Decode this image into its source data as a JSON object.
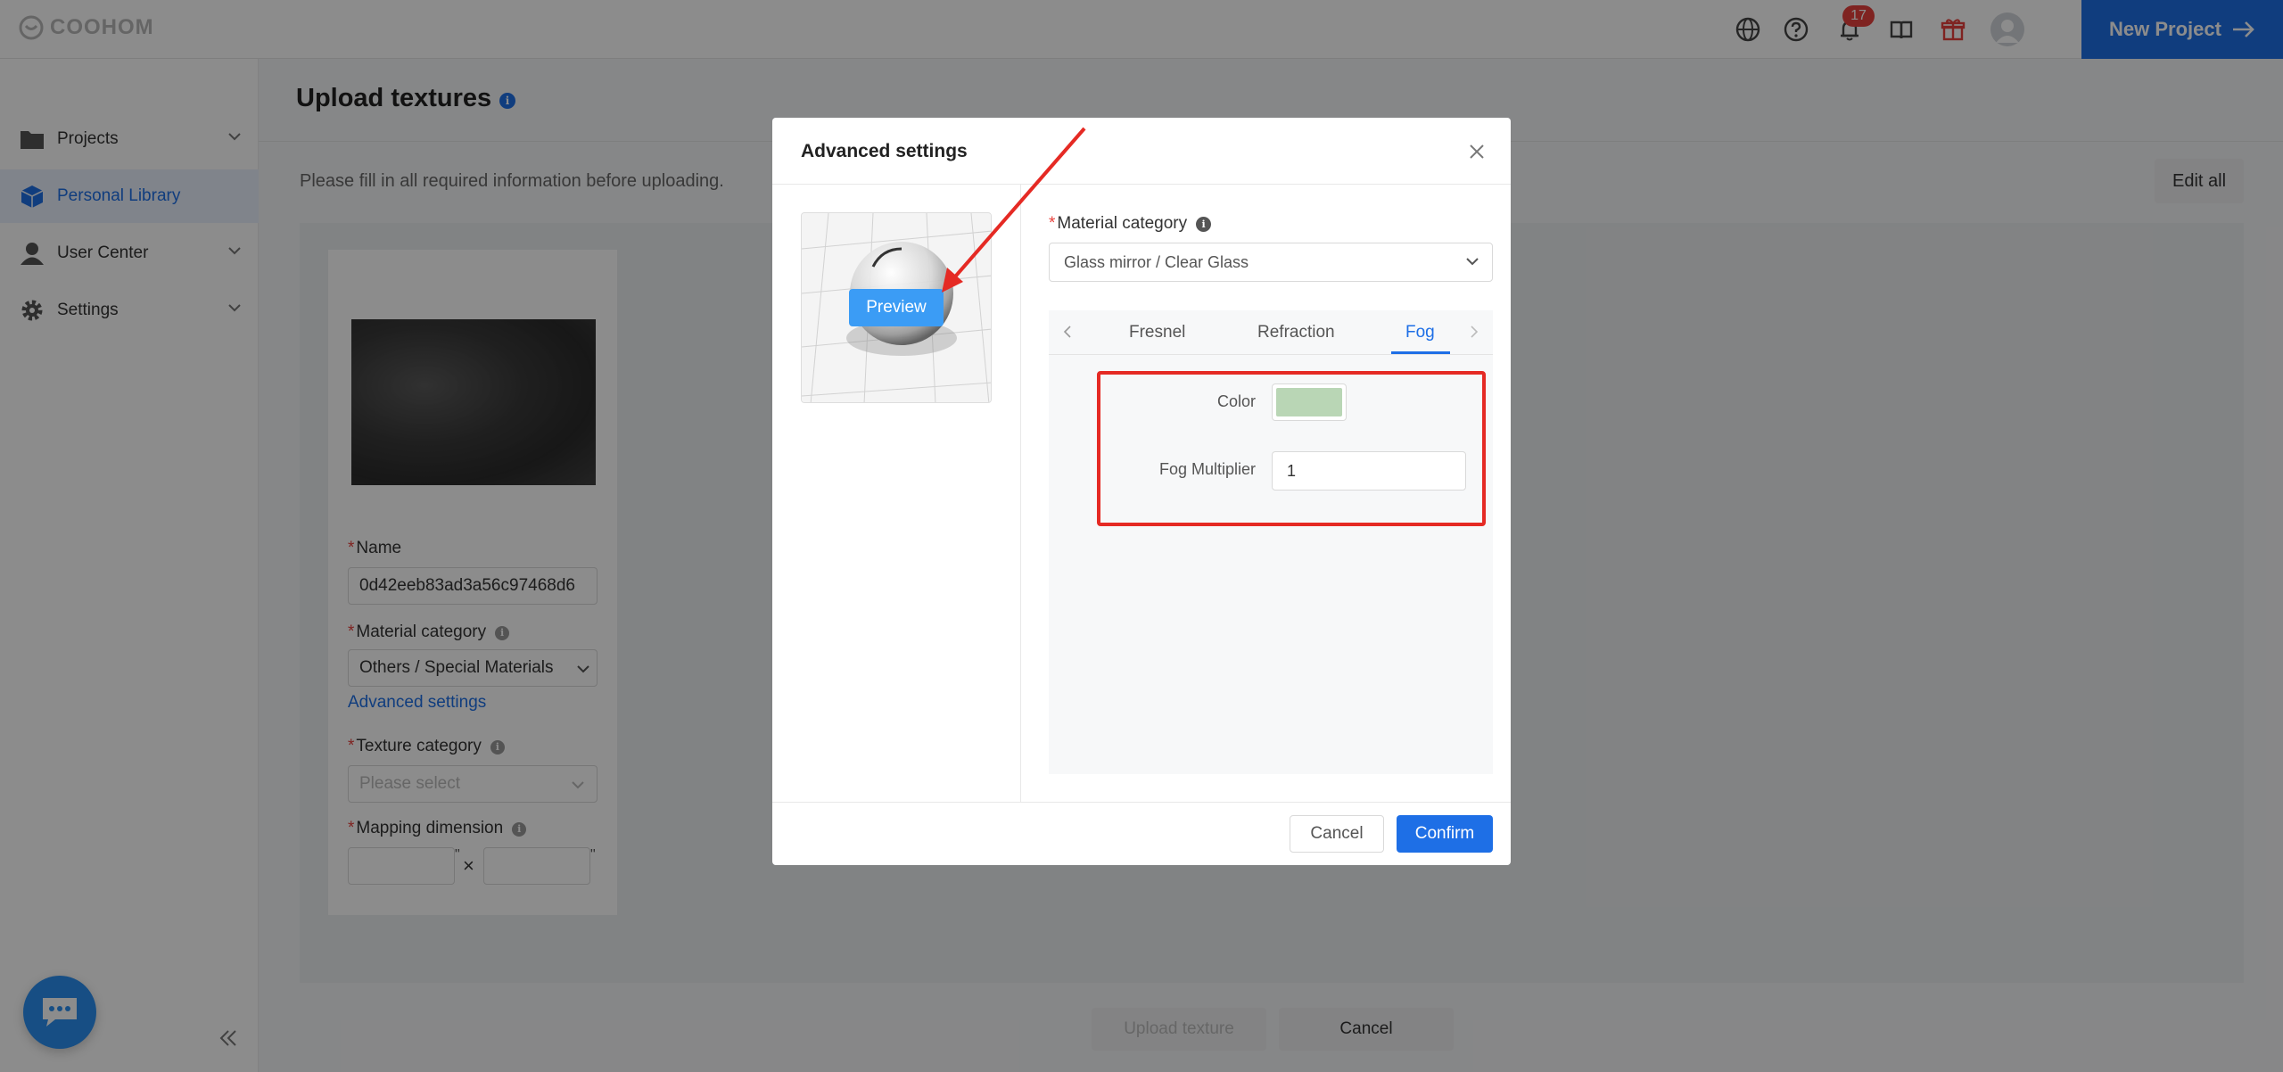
{
  "app": {
    "logo_text": "COOHOM"
  },
  "topbar": {
    "notification_count": "17",
    "new_project_label": "New Project",
    "icons": [
      "globe-icon",
      "help-icon",
      "bell-icon",
      "book-icon",
      "gift-icon",
      "avatar"
    ]
  },
  "sidebar": {
    "items": [
      {
        "label": "Projects",
        "icon": "folder-icon",
        "expandable": true
      },
      {
        "label": "Personal Library",
        "icon": "cube-icon",
        "active": true
      },
      {
        "label": "User Center",
        "icon": "user-icon",
        "expandable": true
      },
      {
        "label": "Settings",
        "icon": "gear-icon",
        "expandable": true
      }
    ]
  },
  "page": {
    "title": "Upload textures",
    "hint": "Please fill in all required information before uploading.",
    "edit_all_label": "Edit all",
    "upload_button": "Upload texture",
    "cancel_button": "Cancel"
  },
  "texture_card": {
    "name_label": "Name",
    "name_value": "0d42eeb83ad3a56c97468d6",
    "material_category_label": "Material category",
    "material_category_value": "Others / Special Materials",
    "advanced_settings_link": "Advanced settings",
    "texture_category_label": "Texture category",
    "texture_category_placeholder": "Please select",
    "mapping_dimension_label": "Mapping dimension",
    "width_unit": "\"",
    "height_unit": "\"",
    "times_symbol": "×"
  },
  "modal": {
    "title": "Advanced settings",
    "preview_button": "Preview",
    "material_category_label": "Material category",
    "material_category_value": "Glass mirror / Clear Glass",
    "tabs": [
      {
        "label": "Fresnel"
      },
      {
        "label": "Refraction"
      },
      {
        "label": "Fog",
        "active": true
      }
    ],
    "color_label": "Color",
    "color_value": "#b9d6b5",
    "fog_multiplier_label": "Fog Multiplier",
    "fog_multiplier_value": "1",
    "cancel_label": "Cancel",
    "confirm_label": "Confirm"
  },
  "colors": {
    "accent": "#1e6fe6",
    "highlight": "#e52a24",
    "preview_button": "#3b9cf5"
  }
}
